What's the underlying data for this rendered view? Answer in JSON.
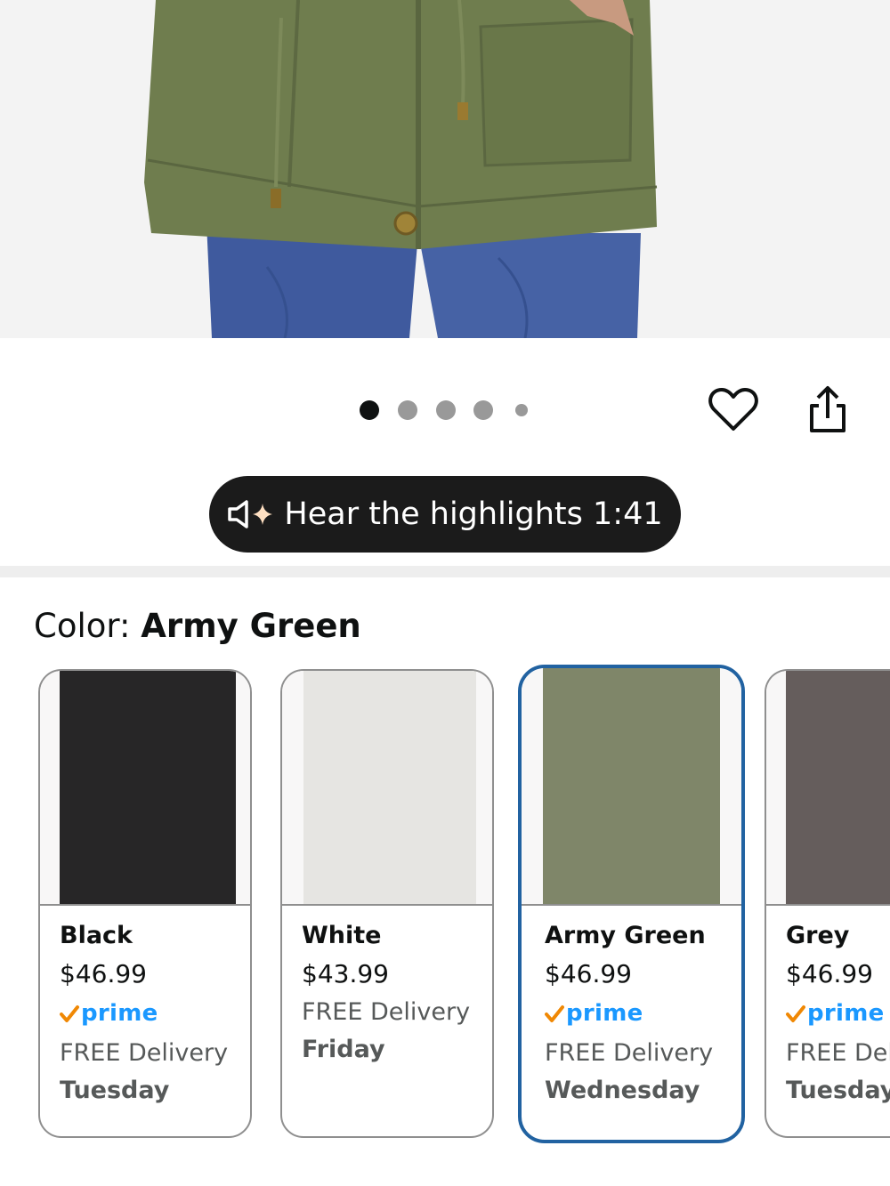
{
  "product_image": {
    "alt": ""
  },
  "carousel": {
    "count": 5,
    "active_index": 0
  },
  "actions": {
    "wishlist_icon": "heart-icon",
    "share_icon": "share-icon"
  },
  "audio": {
    "label": "Hear the highlights 1:41",
    "icon": "speaker-sparkle-icon"
  },
  "color": {
    "label": "Color: ",
    "selected": "Army Green"
  },
  "swatches": [
    {
      "name": "Black",
      "price": "$46.99",
      "prime": "prime",
      "delivery": "FREE Delivery",
      "day": "Tuesday",
      "color": "#272627"
    },
    {
      "name": "White",
      "price": "$43.99",
      "prime": "",
      "delivery": "FREE Delivery",
      "day": "Friday",
      "color": "#e6e5e2"
    },
    {
      "name": "Army Green",
      "price": "$46.99",
      "prime": "prime",
      "delivery": "FREE Delivery",
      "day": "Wednesday",
      "color": "#7f8669",
      "selected": true
    },
    {
      "name": "Grey",
      "price": "$46.99",
      "prime": "prime",
      "delivery": "FREE Delivery",
      "day": "Tuesday",
      "color": "#655d5c"
    }
  ],
  "colors": {
    "selected_border": "#2162a1",
    "prime_blue": "#1a98ff",
    "prime_check": "#f08804"
  }
}
